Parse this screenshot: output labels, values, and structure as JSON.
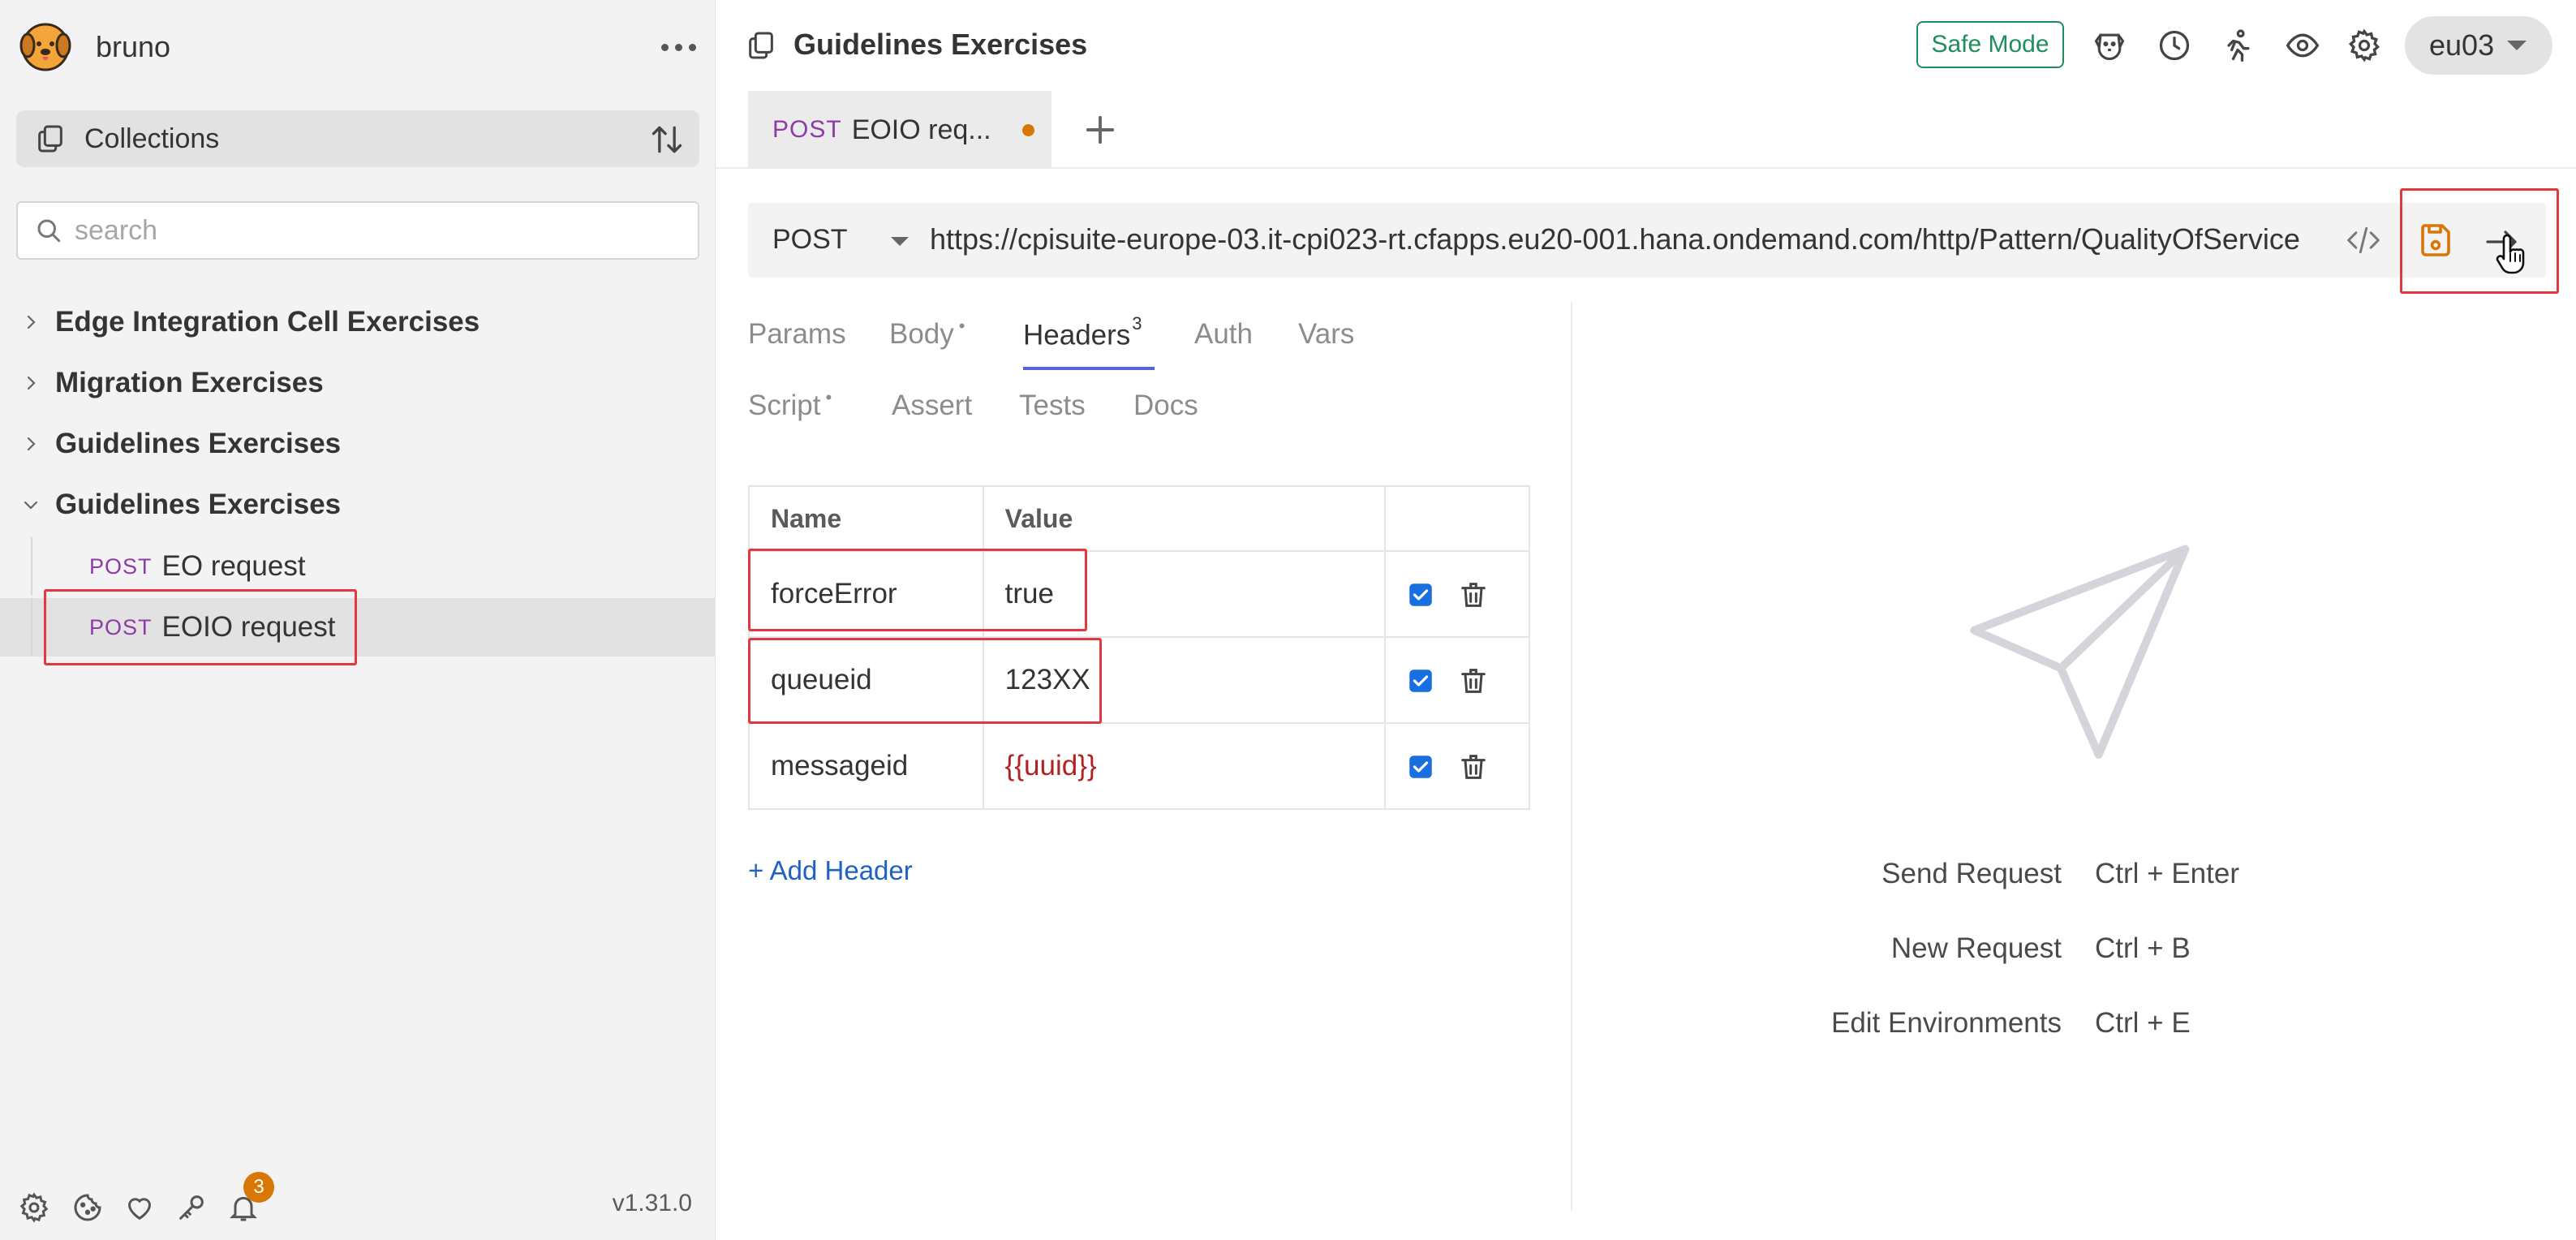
{
  "sidebar": {
    "brand": "bruno",
    "collections_label": "Collections",
    "search_placeholder": "search",
    "collections": [
      {
        "name": "Edge Integration Cell Exercises",
        "expanded": false
      },
      {
        "name": "Migration Exercises",
        "expanded": false
      },
      {
        "name": "Guidelines Exercises",
        "expanded": false
      },
      {
        "name": "Guidelines Exercises",
        "expanded": true
      }
    ],
    "requests": [
      {
        "method": "POST",
        "name": "EO request",
        "active": false
      },
      {
        "method": "POST",
        "name": "EOIO request",
        "active": true
      }
    ],
    "notification_count": "3",
    "version": "v1.31.0"
  },
  "topbar": {
    "collection_title": "Guidelines Exercises",
    "safe_mode": "Safe Mode",
    "environment": "eu03"
  },
  "tab": {
    "method": "POST",
    "name": "EOIO req...",
    "unsaved": true
  },
  "request": {
    "method": "POST",
    "url": "https://cpisuite-europe-03.it-cpi023-rt.cfapps.eu20-001.hana.ondemand.com/http/Pattern/QualityOfService"
  },
  "request_tabs": {
    "params": "Params",
    "body": "Body",
    "headers": "Headers",
    "headers_count": "3",
    "auth": "Auth",
    "vars": "Vars",
    "script": "Script",
    "assert": "Assert",
    "tests": "Tests",
    "docs": "Docs",
    "modified_mark": "•"
  },
  "headers_table": {
    "col_name": "Name",
    "col_value": "Value",
    "rows": [
      {
        "name": "forceError",
        "value": "true",
        "enabled": true
      },
      {
        "name": "queueid",
        "value": "123XX",
        "enabled": true
      },
      {
        "name": "messageid",
        "value": "{{uuid}}",
        "enabled": true
      }
    ],
    "add_label": "+ Add Header"
  },
  "shortcuts": [
    {
      "label": "Send Request",
      "keys": "Ctrl + Enter"
    },
    {
      "label": "New Request",
      "keys": "Ctrl + B"
    },
    {
      "label": "Edit Environments",
      "keys": "Ctrl + E"
    }
  ],
  "colors": {
    "method_post": "#8e3ba9",
    "safe_mode": "#1f8e5c",
    "unsaved_dot": "#d97706",
    "save_icon": "#d97706",
    "active_tab_underline": "#5463d6",
    "variable": "#b22222",
    "link": "#1f62c2",
    "annotation": "#e0393e"
  }
}
